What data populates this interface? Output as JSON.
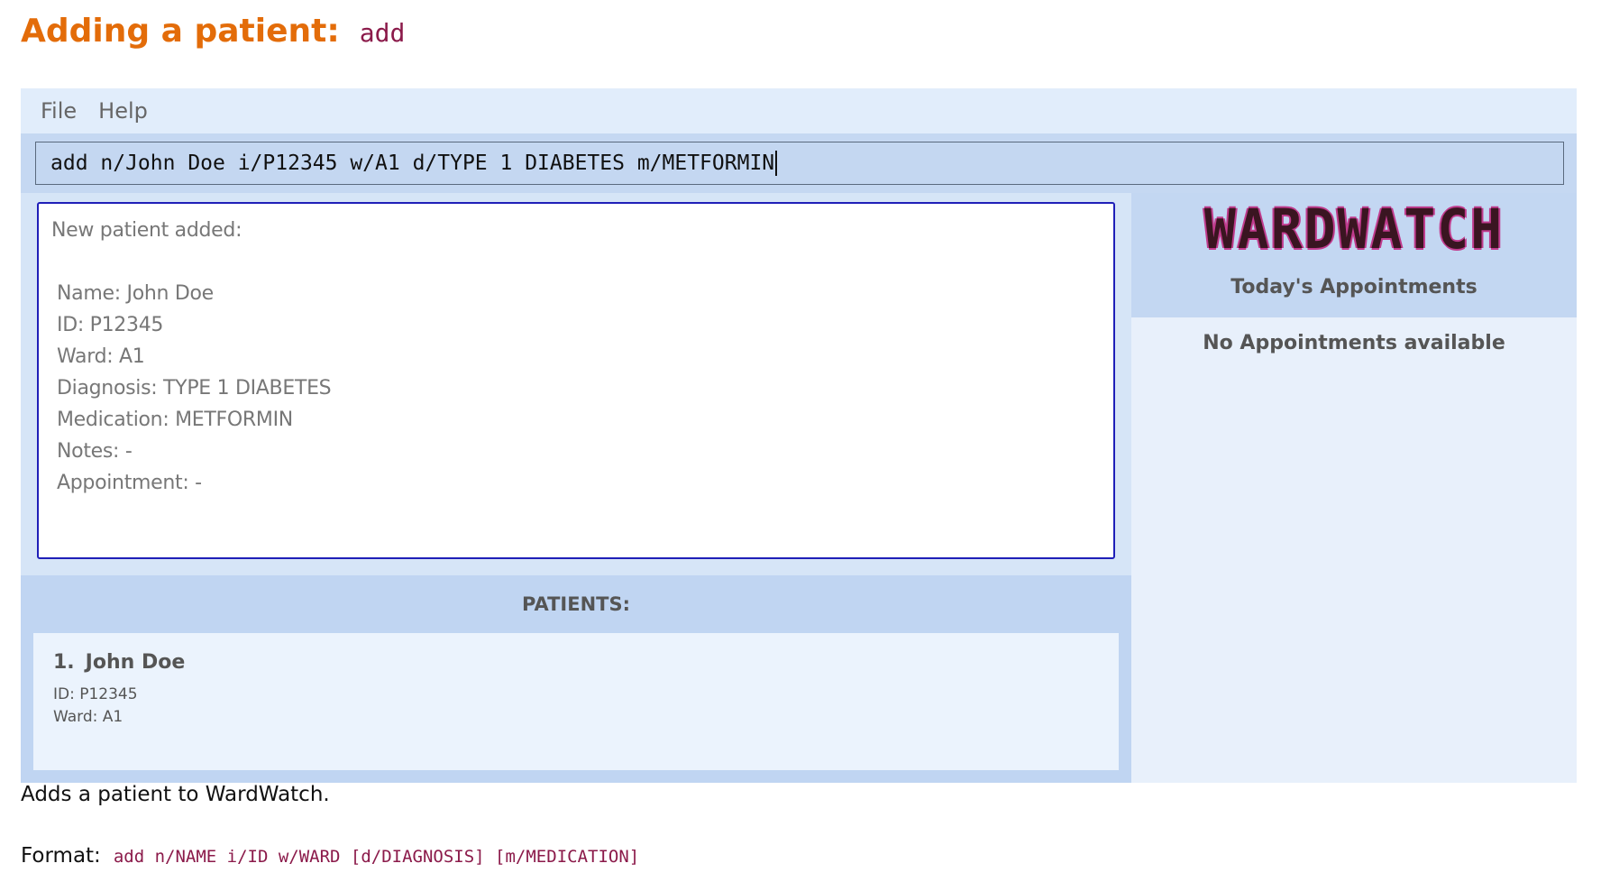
{
  "doc": {
    "heading": "Adding a patient:",
    "heading_code": "add",
    "description": "Adds a patient to WardWatch.",
    "format_label": "Format:",
    "format_code": "add n/NAME i/ID w/WARD [d/DIAGNOSIS] [m/MEDICATION]"
  },
  "app": {
    "menu": {
      "file": "File",
      "help": "Help"
    },
    "command_input": {
      "value": "add n/John Doe i/P12345 w/A1 d/TYPE 1 DIABETES m/METFORMIN"
    },
    "result": {
      "title": "New patient added:",
      "lines": [
        "Name: John Doe",
        "ID: P12345",
        "Ward: A1",
        "Diagnosis: TYPE 1 DIABETES",
        "Medication: METFORMIN",
        "Notes: -",
        "Appointment: -"
      ]
    },
    "patients": {
      "header": "PATIENTS:",
      "items": [
        {
          "index": "1.",
          "name": "John Doe",
          "id": "ID: P12345",
          "ward": "Ward: A1"
        }
      ]
    },
    "sidebar": {
      "logo": "WARDWATCH",
      "appointments_title": "Today's Appointments",
      "appointments_empty": "No Appointments available"
    }
  },
  "colors": {
    "heading": "#e36c09",
    "code": "#8b1a4a",
    "panel": "#c0d5f2",
    "result_border": "#1f1fb8",
    "logo_fill": "#3a1521",
    "logo_outline": "#c03b8d"
  }
}
